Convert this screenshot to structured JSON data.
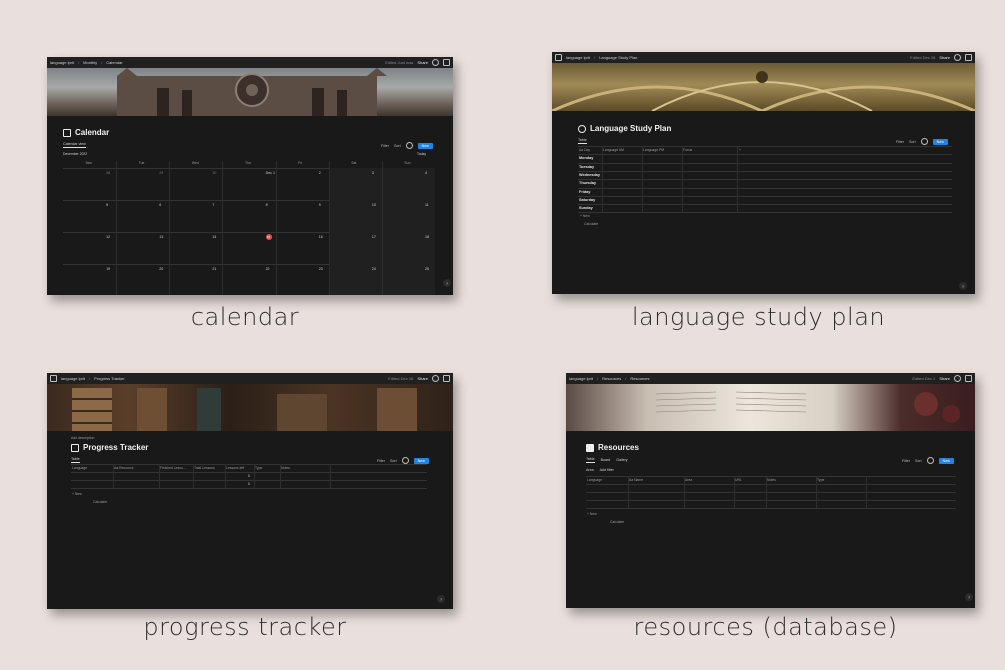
{
  "background_color": "#e9dfdc",
  "accent": "#2383e2",
  "panels": {
    "calendar": {
      "caption": "calendar",
      "breadcrumb": [
        "language lprit",
        "Monthly",
        "Calendar"
      ],
      "edited": "Edited Just now",
      "share": "Share",
      "title": "Calendar",
      "view_tab": "Calendar view",
      "month": "December 2022",
      "today": "Today",
      "filter": "Filter",
      "sort": "Sort",
      "new": "New",
      "weekdays": [
        "Mon",
        "Tue",
        "Wed",
        "Thu",
        "Fri",
        "Sat",
        "Sun"
      ],
      "weeks": [
        [
          "28",
          "29",
          "30",
          "Dec 1",
          "2",
          "3",
          "4"
        ],
        [
          "5",
          "6",
          "7",
          "8",
          "9",
          "10",
          "11"
        ],
        [
          "12",
          "13",
          "14",
          "15",
          "16",
          "17",
          "18"
        ],
        [
          "19",
          "20",
          "21",
          "22",
          "23",
          "24",
          "25"
        ]
      ],
      "today_date": "15"
    },
    "study_plan": {
      "caption": "language study plan",
      "breadcrumb": [
        "language lprit",
        "Language Study Plan"
      ],
      "edited": "Edited Dec 16",
      "share": "Share",
      "title": "Language Study Plan",
      "view_tab": "Table",
      "filter": "Filter",
      "sort": "Sort",
      "new": "New",
      "columns": [
        "Aa Day",
        "Language AM",
        "Language PM",
        "Focus"
      ],
      "days": [
        "Monday",
        "Tuesday",
        "Wednesday",
        "Thursday",
        "Friday",
        "Saturday",
        "Sunday"
      ],
      "add_new": "+ New",
      "calculate": "Calculate"
    },
    "progress": {
      "caption": "progress tracker",
      "breadcrumb": [
        "language lprit",
        "Progress Tracker"
      ],
      "edited": "Edited Dec 16",
      "share": "Share",
      "add_desc": "Add description",
      "title": "Progress Tracker",
      "view_tab": "Table",
      "filter": "Filter",
      "sort": "Sort",
      "new": "New",
      "columns": [
        "Language",
        "Aa Resource",
        "Finished Lesso...",
        "Total Lessons",
        "Lessons left",
        "Type",
        "Notes"
      ],
      "row_values": [
        "0",
        "0"
      ],
      "add_new": "+ New",
      "calculate": "Calculate"
    },
    "resources": {
      "caption": "resources (database)",
      "breadcrumb": [
        "language lprit",
        "Resources",
        "Resources"
      ],
      "edited": "Edited Dec 2",
      "share": "Share",
      "title": "Resources",
      "tabs": [
        "Table",
        "Board",
        "Gallery"
      ],
      "sub_tabs": [
        "Area",
        "Add filter"
      ],
      "filter": "Filter",
      "sort": "Sort",
      "new": "New",
      "columns": [
        "Language",
        "Aa Name",
        "Area",
        "URL",
        "Notes",
        "Type"
      ],
      "add_new": "+ New",
      "calculate": "Calculate"
    }
  }
}
